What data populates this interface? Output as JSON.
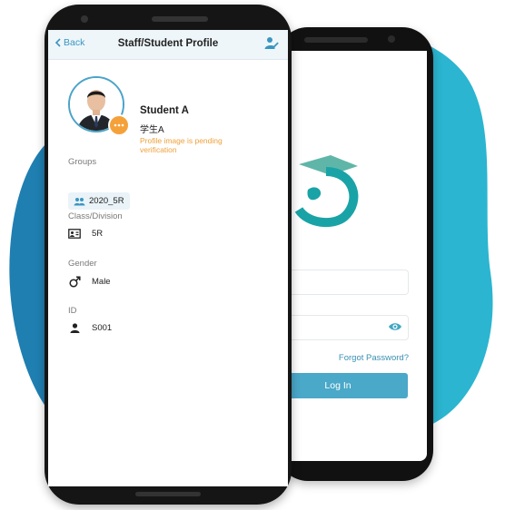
{
  "colors": {
    "accent": "#3b95c2",
    "pending": "#f0a03a",
    "blob": "#2fb0cf"
  },
  "login_screen": {
    "forgot_password": "Forgot Password?",
    "login_button": "Log In",
    "icons": {
      "visibility": "eye-icon"
    }
  },
  "profile": {
    "nav": {
      "back_label": "Back",
      "title": "Staff/Student Profile",
      "edit_icon": "edit-user-icon"
    },
    "name": "Student A",
    "name_alt": "学生A",
    "pending_notice": "Profile image is pending verification",
    "groups": {
      "label": "Groups",
      "items": [
        "2020_5R"
      ]
    },
    "class_division": {
      "label": "Class/Division",
      "value": "5R"
    },
    "gender": {
      "label": "Gender",
      "value": "Male"
    },
    "id": {
      "label": "ID",
      "value": "S001"
    }
  }
}
